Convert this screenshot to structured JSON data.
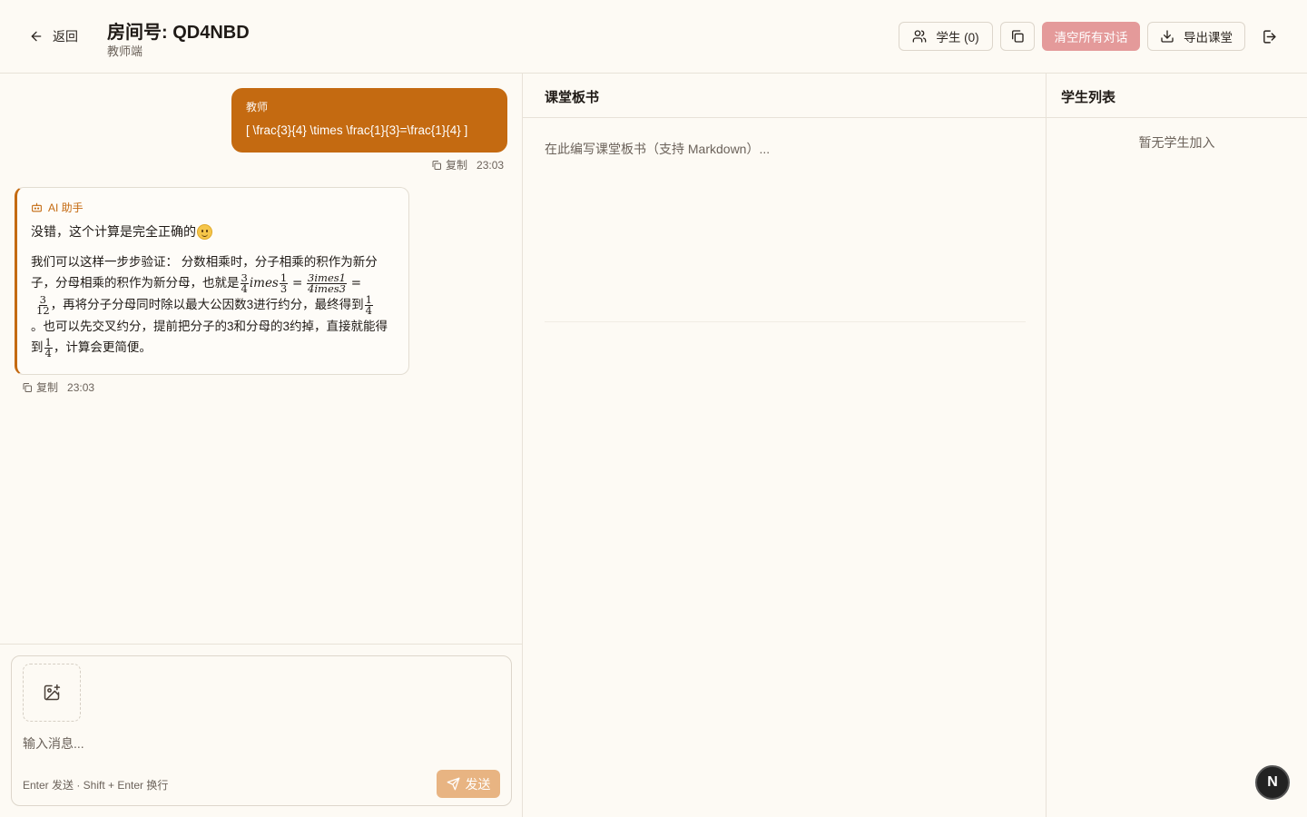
{
  "header": {
    "back_label": "返回",
    "room_title": "房间号: QD4NBD",
    "room_subtitle": "教师端",
    "students_button": "学生 (0)",
    "clear_button": "清空所有对话",
    "export_button": "导出课堂",
    "clear_color": "#e49a9a"
  },
  "chat": {
    "messages": [
      {
        "sender": "教师",
        "text": "[ \\frac{3}{4} \\times \\frac{1}{3}=\\frac{1}{4} ]",
        "copy_label": "复制",
        "time": "23:03",
        "bubble_color": "#c46a11"
      },
      {
        "sender": "AI 助手",
        "line1": "没错，这个计算是完全正确的",
        "emoji": "smiling-face",
        "body_a": "我们可以这样一步步验证： 分数相乘时，分子相乘的积作为新分子，分母相乘的积作为新分母，也就是",
        "f1_num": "3",
        "f1_den": "4",
        "times_text": "imes",
        "f2_num": "1",
        "f2_den": "3",
        "eq": "=",
        "f3_num": "3imes1",
        "f3_den": "4imes3",
        "f4_num": "3",
        "f4_den": "12",
        "body_b": "，再将分子分母同时除以最大公因数3进行约分，最终得到",
        "f5_num": "1",
        "f5_den": "4",
        "body_c": "。也可以先交叉约分，提前把分子的3和分母的3约掉，直接就能得到",
        "f6_num": "1",
        "f6_den": "4",
        "body_d": "，计算会更简便。",
        "copy_label": "复制",
        "time": "23:03",
        "accent_color": "#c46a11"
      }
    ],
    "composer": {
      "placeholder": "输入消息...",
      "hint": "Enter 发送 · Shift + Enter 换行",
      "send_label": "发送"
    }
  },
  "board": {
    "title": "课堂板书",
    "placeholder": "在此编写课堂板书（支持 Markdown）..."
  },
  "students": {
    "title": "学生列表",
    "empty_text": "暂无学生加入"
  },
  "fab_label": "N"
}
